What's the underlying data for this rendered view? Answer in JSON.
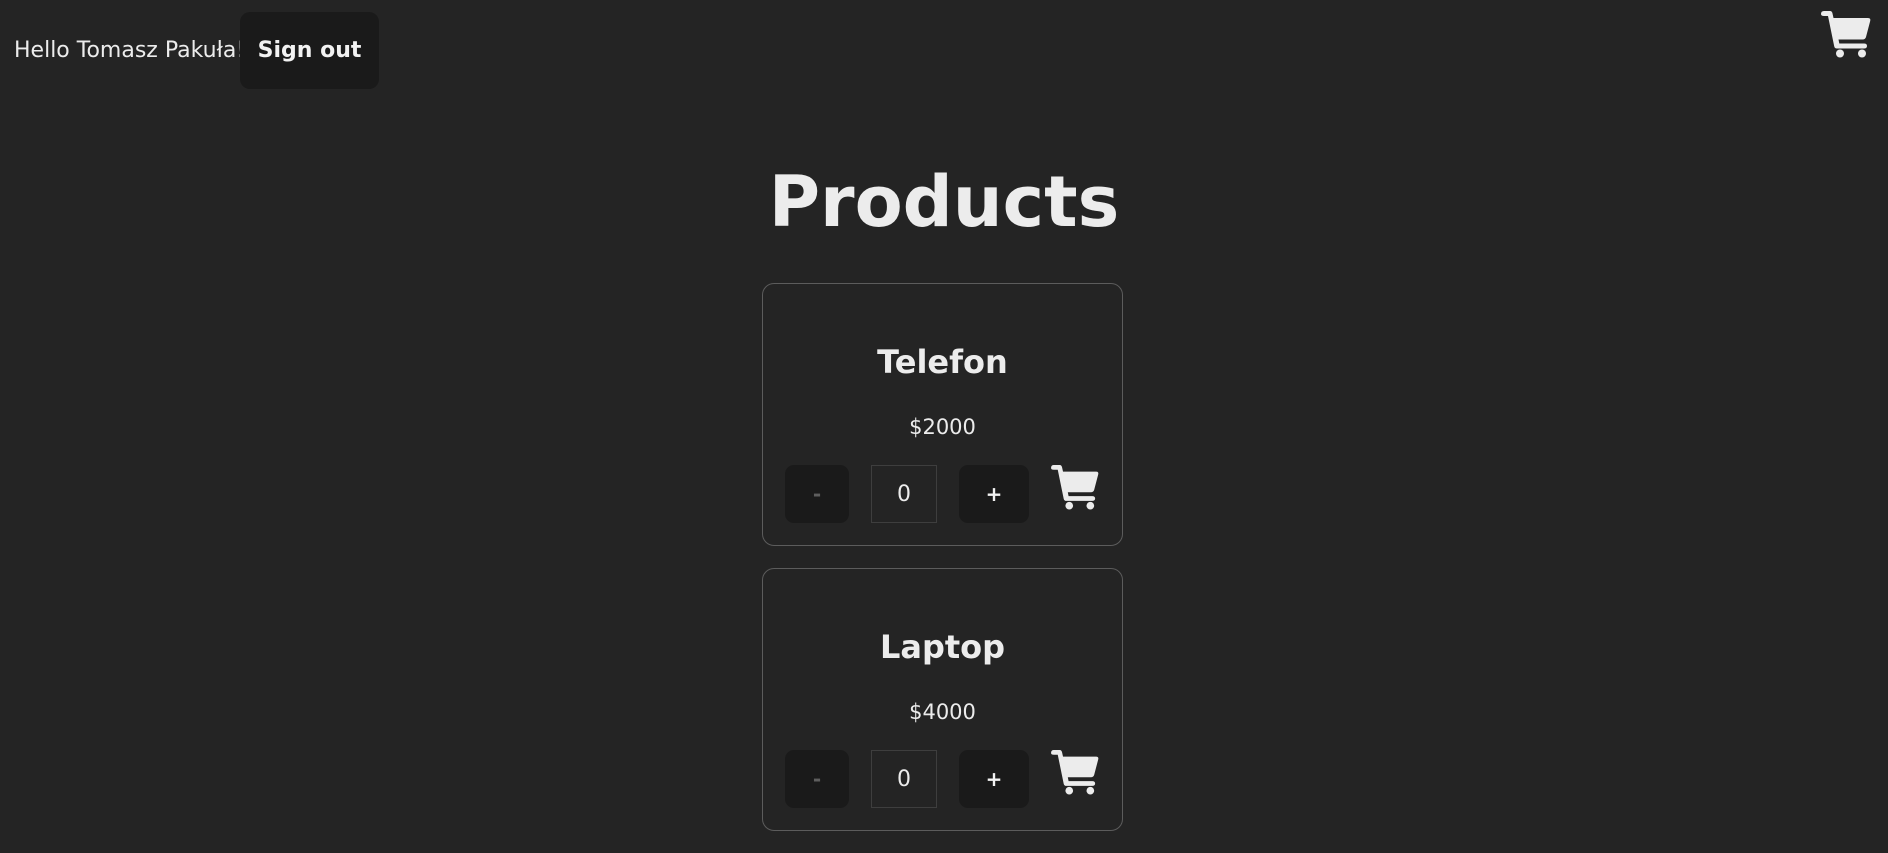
{
  "header": {
    "greeting": "Hello Tomasz Pakuła!",
    "sign_out_label": "Sign out",
    "cart_icon": "shopping-cart-icon"
  },
  "page": {
    "title": "Products"
  },
  "products": [
    {
      "name": "Telefon",
      "price": "$2000",
      "decrement_label": "-",
      "increment_label": "+",
      "quantity": "0",
      "cart_icon": "shopping-cart-icon"
    },
    {
      "name": "Laptop",
      "price": "$4000",
      "decrement_label": "-",
      "increment_label": "+",
      "quantity": "0",
      "cart_icon": "shopping-cart-icon"
    }
  ],
  "colors": {
    "background": "#242424",
    "button_background": "#1a1a1a",
    "text": "#ececec",
    "card_border": "#5c5c5c",
    "disabled_text": "#5e5e5e"
  }
}
